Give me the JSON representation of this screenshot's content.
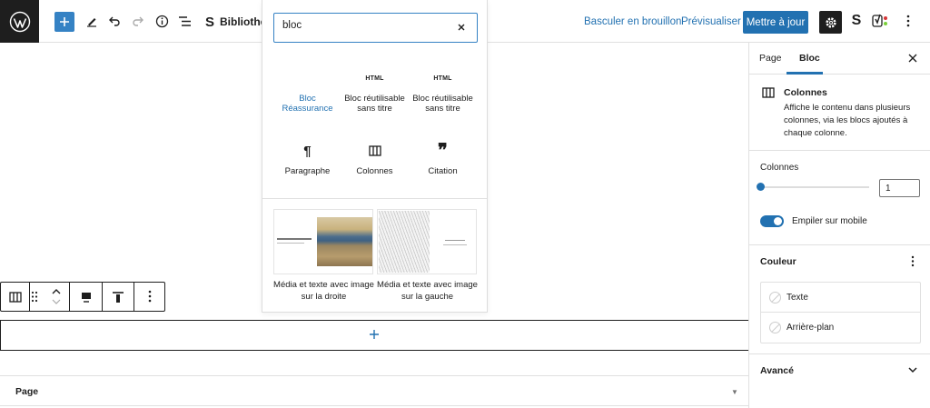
{
  "topbar": {
    "document_title": "Bibliothèque",
    "switch_draft": "Basculer en brouillon",
    "preview": "Prévisualiser",
    "update": "Mettre à jour",
    "icons": [
      "wordpress-logo",
      "plus",
      "pencil",
      "undo",
      "redo",
      "info",
      "list-view",
      "custom-plugin",
      "settings",
      "custom-plugin",
      "yoast",
      "more-vertical"
    ]
  },
  "inserter": {
    "search_value": "bloc",
    "blocks": [
      {
        "label": "Bloc Réassurance",
        "icon": "",
        "highlighted": true
      },
      {
        "label": "Bloc réutilisable sans titre",
        "icon": "HTML"
      },
      {
        "label": "Bloc réutilisable sans titre",
        "icon": "HTML"
      },
      {
        "label": "Paragraphe",
        "icon": "pilcrow"
      },
      {
        "label": "Colonnes",
        "icon": "columns"
      },
      {
        "label": "Citation",
        "icon": "quote"
      }
    ],
    "patterns": [
      {
        "label": "Média et texte avec image sur la droite"
      },
      {
        "label": "Média et texte avec image sur la gauche"
      }
    ]
  },
  "canvas": {
    "page_panel": "Page"
  },
  "sidebar": {
    "tabs": [
      "Page",
      "Bloc"
    ],
    "active_tab": "Bloc",
    "block_name": "Colonnes",
    "block_description": "Affiche le contenu dans plusieurs colonnes, via les blocs ajoutés à chaque colonne.",
    "columns_label": "Colonnes",
    "columns_value": "1",
    "stack_label": "Empiler sur mobile",
    "stack_enabled": true,
    "color_section": "Couleur",
    "color_items": [
      "Texte",
      "Arrière-plan"
    ],
    "advanced": "Avancé"
  },
  "colors": {
    "accent": "#2271b1",
    "dark": "#1e1e1e"
  }
}
